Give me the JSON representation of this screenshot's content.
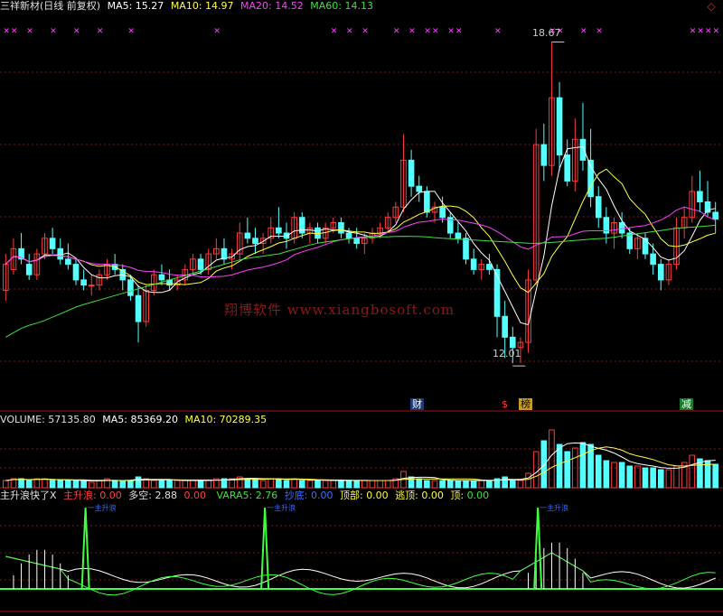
{
  "price_header": {
    "title": "三祥新材(日线 前复权)",
    "ma5": "MA5: 15.27",
    "ma10": "MA10: 14.97",
    "ma20": "MA20: 14.52",
    "ma60": "MA60: 14.13"
  },
  "annotations": {
    "high": "18.67",
    "low": "12.01",
    "watermark": "翔博软件 www.xiangbosoft.com",
    "tag_cai": "财",
    "tag_dollar": "$",
    "tag_bang": "榜",
    "tag_jian": "减",
    "marker_symbol": "✕",
    "spike_label": "一主升浪"
  },
  "volume_header": {
    "volume": "VOLUME: 57135.80",
    "ma5": "MA5: 85369.20",
    "ma10": "MA10: 70289.35"
  },
  "indicator_header": {
    "name": "主升浪快了X",
    "zsl_label": "主升浪:",
    "zsl_value": "0.00",
    "dk_label": "多空:",
    "dk_value": "2.88",
    "extra_value": "0.00",
    "vara5": "VARA5: 2.76",
    "chaodi_label": "抄底:",
    "chaodi_value": "0.00",
    "dingbu_label": "顶部:",
    "dingbu_value": "0.00",
    "taoding_label": "逃顶:",
    "taoding_value": "0.00",
    "ding_label": "顶:",
    "ding_value": "0.00"
  },
  "colors": {
    "up": "#ff3c3c",
    "down": "#54ffff",
    "ma5": "#ffffff",
    "ma10": "#ffff40",
    "ma20": "#ff40ff",
    "ma60": "#40e040",
    "grid": "#7a1a1a",
    "panel_border": "#a01818",
    "marker": "#ff40ff",
    "watermark": "#8a1a1a",
    "spike": "#40ff40",
    "text_blue": "#3a6cff"
  },
  "chart_data": {
    "type": "candlestick",
    "ylim": [
      11.6,
      19.2
    ],
    "ohlc": [
      [
        13.9,
        14.6,
        13.7,
        14.4
      ],
      [
        14.3,
        14.9,
        14.2,
        14.7
      ],
      [
        14.7,
        15.0,
        14.4,
        14.5
      ],
      [
        14.4,
        14.6,
        14.1,
        14.2
      ],
      [
        14.2,
        14.7,
        14.1,
        14.6
      ],
      [
        14.6,
        15.0,
        14.5,
        14.9
      ],
      [
        14.9,
        15.1,
        14.6,
        14.7
      ],
      [
        14.7,
        14.9,
        14.4,
        14.5
      ],
      [
        14.5,
        14.8,
        14.3,
        14.4
      ],
      [
        14.4,
        14.5,
        14.0,
        14.1
      ],
      [
        14.1,
        14.3,
        13.9,
        14.0
      ],
      [
        14.0,
        14.2,
        13.8,
        14.0
      ],
      [
        14.0,
        14.3,
        13.9,
        14.2
      ],
      [
        14.2,
        14.5,
        14.1,
        14.4
      ],
      [
        14.4,
        14.6,
        14.2,
        14.3
      ],
      [
        14.3,
        14.4,
        13.9,
        14.1
      ],
      [
        14.1,
        14.2,
        13.7,
        13.8
      ],
      [
        13.8,
        14.0,
        12.9,
        13.3
      ],
      [
        13.3,
        14.0,
        13.2,
        13.9
      ],
      [
        13.9,
        14.3,
        13.8,
        14.2
      ],
      [
        14.2,
        14.4,
        14.0,
        14.1
      ],
      [
        14.1,
        14.3,
        13.9,
        14.0
      ],
      [
        14.0,
        14.2,
        13.9,
        14.1
      ],
      [
        14.1,
        14.4,
        14.0,
        14.3
      ],
      [
        14.3,
        14.6,
        14.2,
        14.5
      ],
      [
        14.5,
        14.6,
        14.2,
        14.3
      ],
      [
        14.3,
        14.7,
        14.2,
        14.6
      ],
      [
        14.6,
        14.9,
        14.5,
        14.7
      ],
      [
        14.7,
        14.9,
        14.4,
        14.5
      ],
      [
        14.5,
        14.7,
        14.3,
        14.6
      ],
      [
        14.6,
        15.2,
        14.5,
        15.0
      ],
      [
        15.0,
        15.3,
        14.8,
        14.9
      ],
      [
        14.9,
        15.1,
        14.6,
        14.8
      ],
      [
        14.8,
        15.0,
        14.6,
        14.9
      ],
      [
        14.9,
        15.3,
        14.8,
        15.1
      ],
      [
        15.1,
        15.5,
        14.9,
        15.0
      ],
      [
        15.0,
        15.2,
        14.7,
        14.9
      ],
      [
        14.9,
        15.4,
        14.8,
        15.3
      ],
      [
        15.3,
        15.4,
        14.9,
        15.0
      ],
      [
        15.0,
        15.2,
        14.8,
        15.1
      ],
      [
        15.1,
        15.2,
        14.8,
        14.9
      ],
      [
        14.9,
        15.2,
        14.8,
        15.1
      ],
      [
        15.1,
        15.3,
        15.0,
        15.2
      ],
      [
        15.2,
        15.3,
        14.9,
        15.0
      ],
      [
        15.0,
        15.1,
        14.8,
        14.9
      ],
      [
        14.9,
        15.1,
        14.7,
        14.8
      ],
      [
        14.8,
        15.0,
        14.6,
        14.9
      ],
      [
        14.9,
        15.1,
        14.8,
        15.0
      ],
      [
        15.0,
        15.2,
        14.9,
        15.1
      ],
      [
        15.1,
        15.4,
        15.0,
        15.3
      ],
      [
        15.3,
        15.6,
        15.2,
        15.5
      ],
      [
        15.5,
        16.9,
        15.4,
        16.4
      ],
      [
        16.4,
        16.6,
        15.7,
        15.9
      ],
      [
        15.9,
        16.1,
        15.6,
        15.8
      ],
      [
        15.8,
        15.9,
        15.3,
        15.4
      ],
      [
        15.4,
        15.6,
        15.2,
        15.5
      ],
      [
        15.5,
        15.7,
        15.2,
        15.3
      ],
      [
        15.3,
        15.4,
        14.9,
        15.0
      ],
      [
        15.0,
        15.2,
        14.8,
        14.9
      ],
      [
        14.9,
        15.0,
        14.4,
        14.5
      ],
      [
        14.5,
        14.7,
        14.2,
        14.3
      ],
      [
        14.3,
        14.5,
        14.1,
        14.4
      ],
      [
        14.4,
        14.6,
        14.2,
        14.3
      ],
      [
        14.3,
        14.4,
        13.0,
        13.4
      ],
      [
        13.4,
        13.7,
        12.6,
        13.0
      ],
      [
        13.0,
        13.2,
        12.5,
        12.8
      ],
      [
        12.8,
        13.0,
        12.5,
        12.9
      ],
      [
        12.9,
        14.3,
        12.7,
        14.1
      ],
      [
        14.1,
        17.0,
        14.0,
        16.7
      ],
      [
        16.7,
        17.1,
        16.0,
        16.3
      ],
      [
        16.3,
        18.67,
        16.1,
        17.6
      ],
      [
        17.6,
        17.9,
        16.2,
        16.5
      ],
      [
        16.5,
        16.8,
        15.9,
        16.0
      ],
      [
        16.0,
        17.2,
        15.8,
        16.8
      ],
      [
        16.8,
        17.5,
        16.2,
        16.4
      ],
      [
        16.4,
        17.0,
        15.5,
        15.7
      ],
      [
        15.7,
        15.9,
        15.1,
        15.3
      ],
      [
        15.3,
        15.5,
        14.8,
        15.0
      ],
      [
        15.0,
        15.3,
        14.7,
        15.2
      ],
      [
        15.2,
        15.4,
        14.9,
        15.0
      ],
      [
        15.0,
        15.1,
        14.6,
        14.7
      ],
      [
        14.7,
        15.0,
        14.5,
        14.9
      ],
      [
        14.9,
        15.0,
        14.5,
        14.6
      ],
      [
        14.6,
        14.8,
        14.2,
        14.4
      ],
      [
        14.4,
        14.5,
        13.9,
        14.1
      ],
      [
        14.1,
        14.5,
        14.0,
        14.4
      ],
      [
        14.4,
        15.3,
        14.3,
        15.1
      ],
      [
        15.1,
        15.5,
        14.9,
        15.3
      ],
      [
        15.3,
        16.1,
        15.2,
        15.8
      ],
      [
        15.8,
        16.2,
        15.4,
        15.6
      ],
      [
        15.6,
        16.0,
        15.3,
        15.4
      ],
      [
        15.4,
        15.6,
        15.0,
        15.27
      ]
    ],
    "ma60": [
      13.0,
      13.2,
      13.3,
      13.45,
      13.6,
      13.7,
      13.8,
      13.9,
      14.0,
      14.1,
      14.2,
      14.3,
      14.4,
      14.5,
      14.55,
      14.6,
      14.7,
      14.8,
      14.85,
      14.9,
      14.92,
      14.93,
      14.94,
      14.93,
      14.9,
      14.88,
      14.86,
      14.84,
      14.82,
      14.8,
      14.82,
      14.85,
      14.88,
      14.9,
      14.95,
      15.0,
      15.05,
      15.1,
      15.12,
      15.15
    ],
    "volume": [
      4,
      5,
      5,
      4,
      5,
      5,
      4,
      4,
      4,
      4,
      4,
      3,
      4,
      5,
      4,
      4,
      4,
      6,
      5,
      4,
      4,
      4,
      4,
      4,
      4,
      4,
      4,
      5,
      5,
      5,
      6,
      5,
      5,
      4,
      5,
      5,
      4,
      5,
      4,
      4,
      4,
      4,
      4,
      4,
      4,
      4,
      4,
      4,
      4,
      4,
      5,
      9,
      6,
      5,
      4,
      4,
      4,
      4,
      4,
      4,
      4,
      4,
      4,
      5,
      6,
      4,
      4,
      8,
      20,
      26,
      32,
      24,
      20,
      22,
      25,
      24,
      18,
      15,
      14,
      14,
      12,
      12,
      11,
      11,
      10,
      10,
      12,
      14,
      18,
      16,
      15,
      13
    ],
    "volume_ylim": [
      0,
      34
    ]
  }
}
